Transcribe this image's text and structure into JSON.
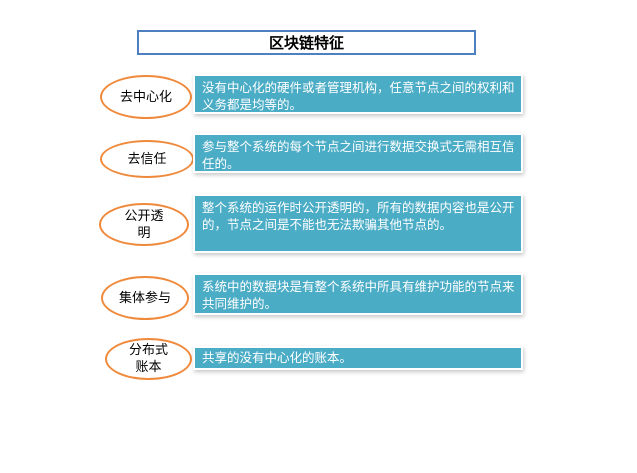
{
  "title": "区块链特征",
  "features": [
    {
      "name": "去中心化",
      "description": "没有中心化的硬件或者管理机构，任意节点之间的权利和义务都是均等的。"
    },
    {
      "name": "去信任",
      "description": "参与整个系统的每个节点之间进行数据交换式无需相互信任的。"
    },
    {
      "name": "公开透明",
      "description": "整个系统的运作时公开透明的，所有的数据内容也是公开的，节点之间是不能也无法欺骗其他节点的。"
    },
    {
      "name": "集体参与",
      "description": "系统中的数据块是有整个系统中所具有维护功能的节点来共同维护的。"
    },
    {
      "name": "分布式账本",
      "description": "共享的没有中心化的账本。"
    }
  ],
  "colors": {
    "title_border": "#4e7fc0",
    "oval_border": "#ef8a3c",
    "desc_fill": "#4bacc6"
  }
}
